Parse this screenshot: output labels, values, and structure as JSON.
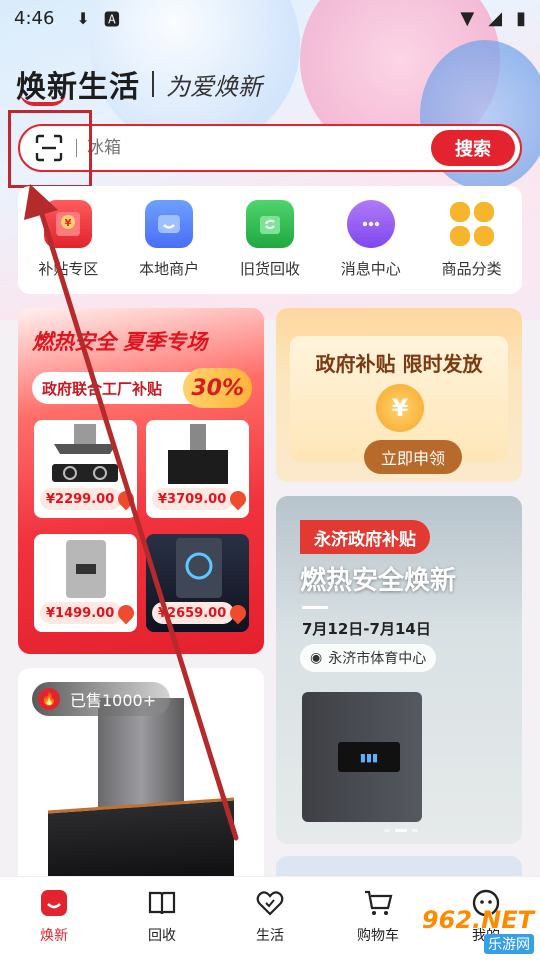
{
  "status_bar": {
    "time": "4:46"
  },
  "brand": {
    "name": "焕新生活",
    "slogan": "为爱焕新"
  },
  "search": {
    "placeholder": "冰箱",
    "button": "搜索"
  },
  "quick_nav": [
    {
      "label": "补贴专区",
      "icon": "red-envelope-icon",
      "color": "#e8313a"
    },
    {
      "label": "本地商户",
      "icon": "shop-icon",
      "color": "#4a7df5"
    },
    {
      "label": "旧货回收",
      "icon": "recycle-icon",
      "color": "#2fb84f"
    },
    {
      "label": "消息中心",
      "icon": "chat-bubble-icon",
      "color": "#8a52f0"
    },
    {
      "label": "商品分类",
      "icon": "category-icon",
      "color": "#f5b22c"
    }
  ],
  "promo_left": {
    "title": "燃热安全 夏季专场",
    "tag": "政府联合工厂补贴",
    "percent": "30%",
    "products": [
      {
        "price": "¥2299.00"
      },
      {
        "price": "¥3709.00"
      },
      {
        "price": "¥1499.00"
      },
      {
        "price": "¥2659.00"
      }
    ]
  },
  "promo_subsidy": {
    "title": "政府补贴 限时发放",
    "coin": "¥",
    "button": "立即申领"
  },
  "promo_event": {
    "tag": "永济政府补贴",
    "title": "燃热安全焕新",
    "date": "7月12日-7月14日",
    "location": "永济市体育中心"
  },
  "product_card": {
    "badge": "已售1000+"
  },
  "tabbar": [
    {
      "label": "焕新",
      "active": true
    },
    {
      "label": "回收",
      "active": false
    },
    {
      "label": "生活",
      "active": false
    },
    {
      "label": "购物车",
      "active": false
    },
    {
      "label": "我的",
      "active": false
    }
  ],
  "watermark": {
    "line1": "962.NET",
    "line2": "乐游网"
  },
  "colors": {
    "accent": "#e3242e",
    "annotation": "#b52a2a"
  }
}
